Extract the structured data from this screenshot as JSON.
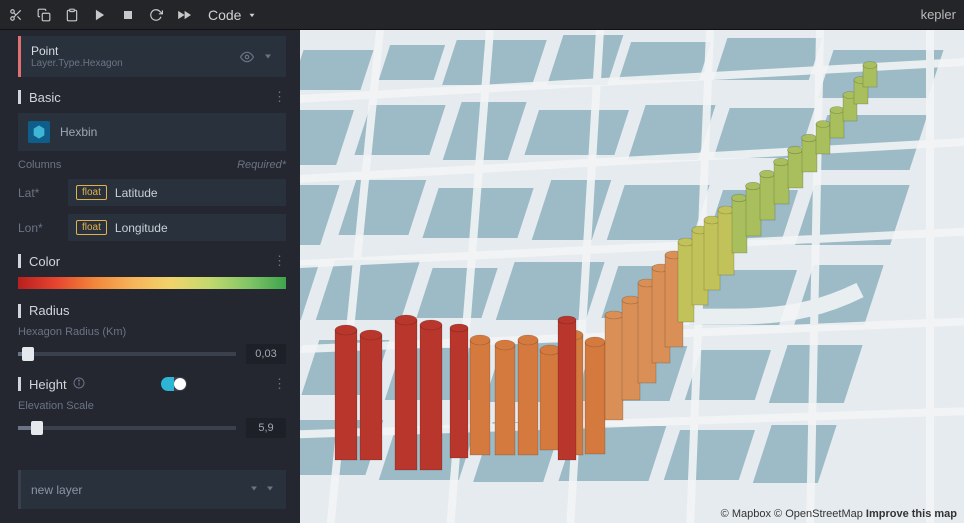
{
  "toolbar": {
    "mode_label": "Code",
    "brand": "kepler"
  },
  "sidebar": {
    "layer_point": {
      "title": "Point",
      "subtitle": "Layer.Type.Hexagon"
    },
    "basic": {
      "label": "Basic",
      "layer_type": "Hexbin"
    },
    "columns": {
      "label": "Columns",
      "required": "Required*",
      "lat_label": "Lat*",
      "lat_tag": "float",
      "lat_field": "Latitude",
      "lon_label": "Lon*",
      "lon_tag": "float",
      "lon_field": "Longitude"
    },
    "color": {
      "label": "Color",
      "gradient_stops": [
        "#b71f1f",
        "#e6452f",
        "#f1873a",
        "#f6b45a",
        "#f0d46b",
        "#c3d96e",
        "#84c667",
        "#3fa34d"
      ]
    },
    "radius": {
      "label": "Radius",
      "field_label": "Hexagon Radius (Km)",
      "value": "0,03"
    },
    "height": {
      "label": "Height",
      "toggle_on": true,
      "field_label": "Elevation Scale",
      "value": "5,9"
    },
    "new_layer": "new layer"
  },
  "map": {
    "attribution_mapbox": "© Mapbox",
    "attribution_osm": "© OpenStreetMap",
    "improve": "Improve this map"
  }
}
